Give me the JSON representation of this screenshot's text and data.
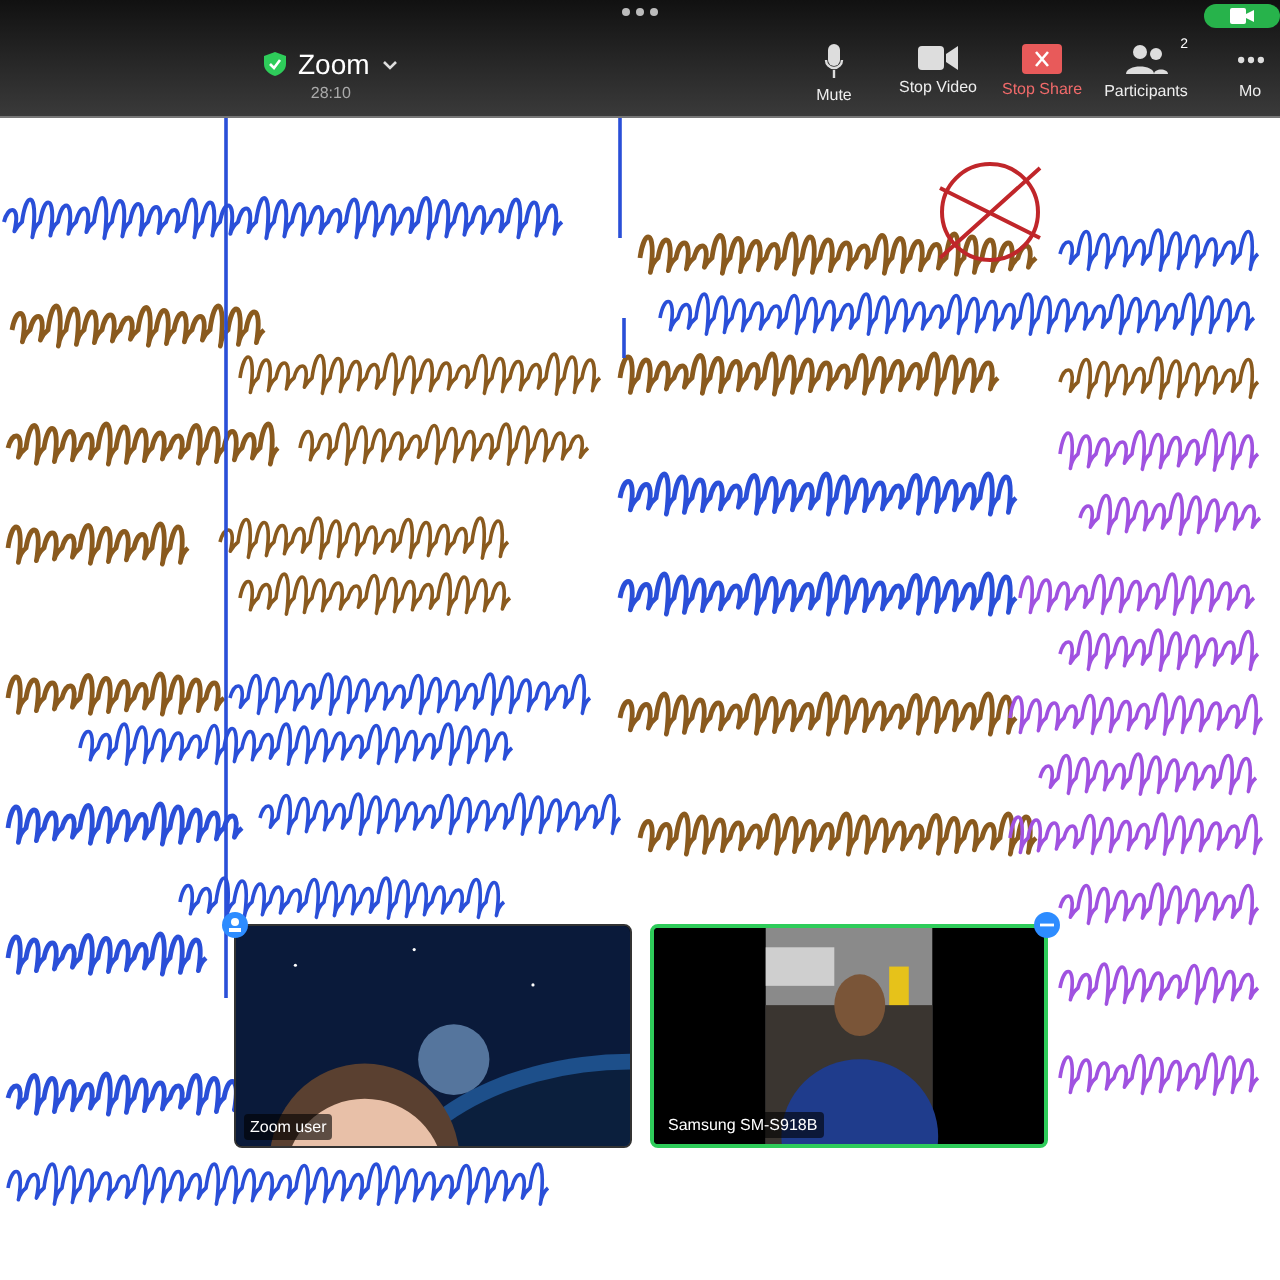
{
  "top_bar": {
    "title": "Zoom",
    "elapsed": "28:10",
    "encrypted": true
  },
  "toolbar": [
    {
      "kind": "mic",
      "label": "Mute"
    },
    {
      "kind": "video",
      "label": "Stop Video"
    },
    {
      "kind": "share",
      "label": "Stop Share"
    },
    {
      "kind": "participants",
      "label": "Participants",
      "count": "2"
    },
    {
      "kind": "more",
      "label": "Mo"
    }
  ],
  "videos": [
    {
      "name": "Zoom user",
      "active_speaker": false
    },
    {
      "name": "Samsung SM-S918B",
      "active_speaker": true
    }
  ]
}
